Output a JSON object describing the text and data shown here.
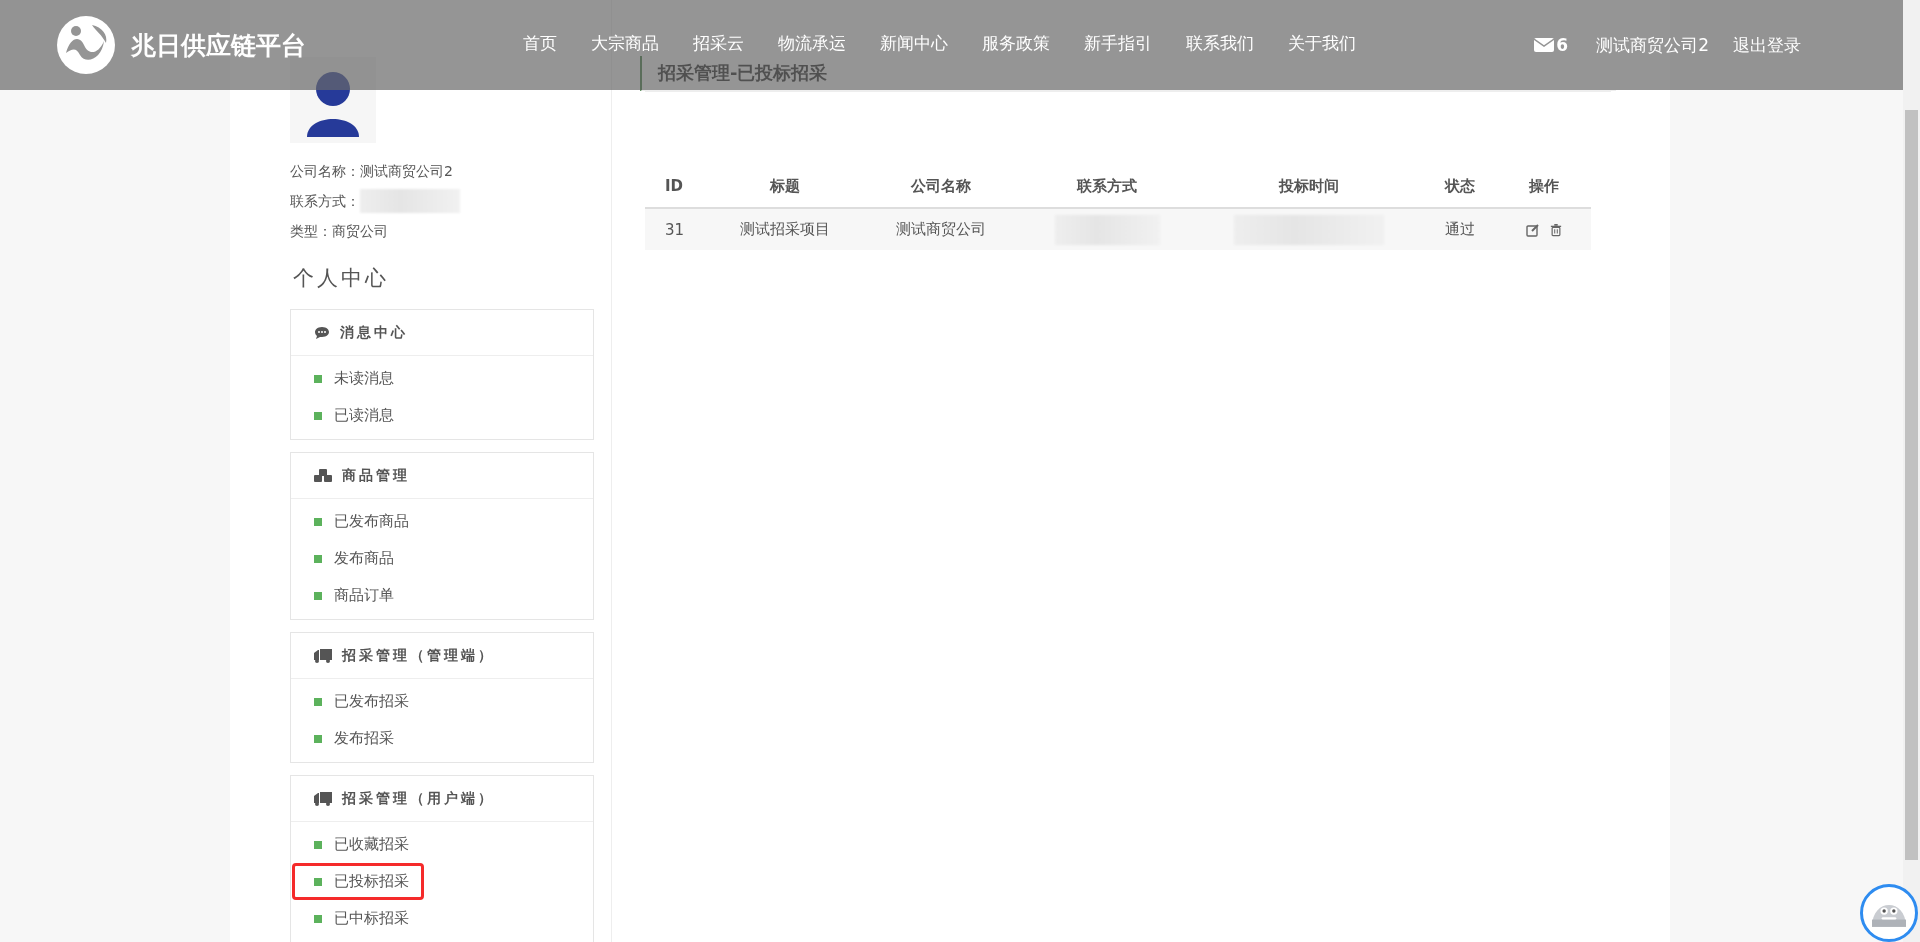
{
  "header": {
    "logo_text": "兆日供应链平台",
    "nav": [
      {
        "label": "首页"
      },
      {
        "label": "大宗商品"
      },
      {
        "label": "招采云"
      },
      {
        "label": "物流承运"
      },
      {
        "label": "新闻中心"
      },
      {
        "label": "服务政策"
      },
      {
        "label": "新手指引"
      },
      {
        "label": "联系我们"
      },
      {
        "label": "关于我们"
      }
    ],
    "messages_count": "6",
    "user": "测试商贸公司2",
    "logout": "退出登录"
  },
  "profile": {
    "company": "公司名称：测试商贸公司2",
    "contact_label": "联系方式：",
    "type": "类型：商贸公司"
  },
  "sidebar": {
    "title": "个人中心",
    "groups": [
      {
        "kind": "chat",
        "title": "消息中心",
        "items": [
          {
            "label": "未读消息",
            "selected": false
          },
          {
            "label": "已读消息",
            "selected": false
          }
        ]
      },
      {
        "kind": "cubes",
        "title": "商品管理",
        "items": [
          {
            "label": "已发布商品",
            "selected": false
          },
          {
            "label": "发布商品",
            "selected": false
          },
          {
            "label": "商品订单",
            "selected": false
          }
        ]
      },
      {
        "kind": "truck",
        "title": "招采管理（管理端）",
        "items": [
          {
            "label": "已发布招采",
            "selected": false
          },
          {
            "label": "发布招采",
            "selected": false
          }
        ]
      },
      {
        "kind": "truck",
        "title": "招采管理（用户端）",
        "items": [
          {
            "label": "已收藏招采",
            "selected": false
          },
          {
            "label": "已投标招采",
            "selected": true
          },
          {
            "label": "已中标招采",
            "selected": false
          }
        ]
      }
    ]
  },
  "main": {
    "title": "招采管理-已投标招采",
    "table": {
      "columns": [
        "ID",
        "标题",
        "公司名称",
        "联系方式",
        "投标时间",
        "状态",
        "操作"
      ],
      "rows": [
        {
          "id": "31",
          "title": "测试招采项目",
          "company": "测试商贸公司",
          "status": "通过"
        }
      ]
    }
  }
}
